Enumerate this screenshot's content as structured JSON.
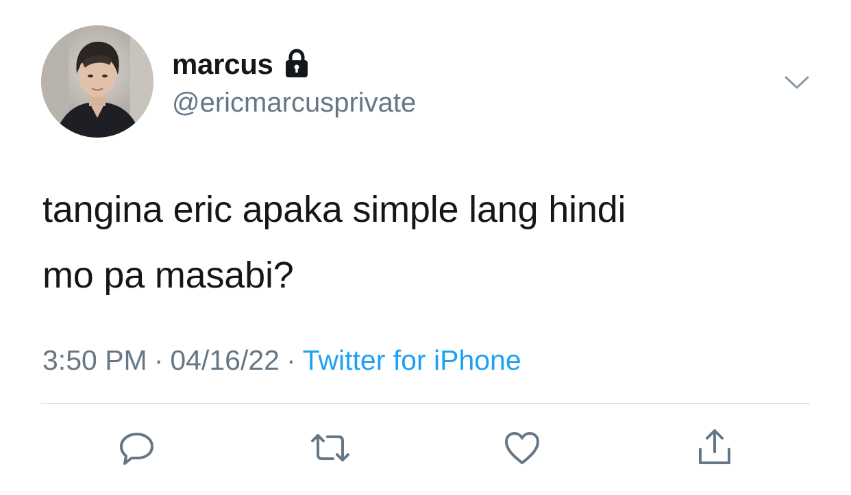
{
  "author": {
    "display_name": "marcus",
    "handle": "@ericmarcusprivate",
    "protected_icon": "lock-icon",
    "avatar_icon": "profile-photo"
  },
  "tweet": {
    "text_line1": "tangina eric apaka simple lang hindi",
    "text_line2": "mo pa masabi?"
  },
  "meta": {
    "time": "3:50 PM",
    "separator": "·",
    "date": "04/16/22",
    "source": "Twitter for iPhone"
  },
  "actions": {
    "reply_icon": "reply-icon",
    "retweet_icon": "retweet-icon",
    "like_icon": "heart-icon",
    "share_icon": "share-icon",
    "more_icon": "chevron-down-icon"
  },
  "colors": {
    "text": "#14171a",
    "secondary": "#657786",
    "link": "#1da1f2",
    "icon": "#657786",
    "divider": "#dcdfe2"
  }
}
